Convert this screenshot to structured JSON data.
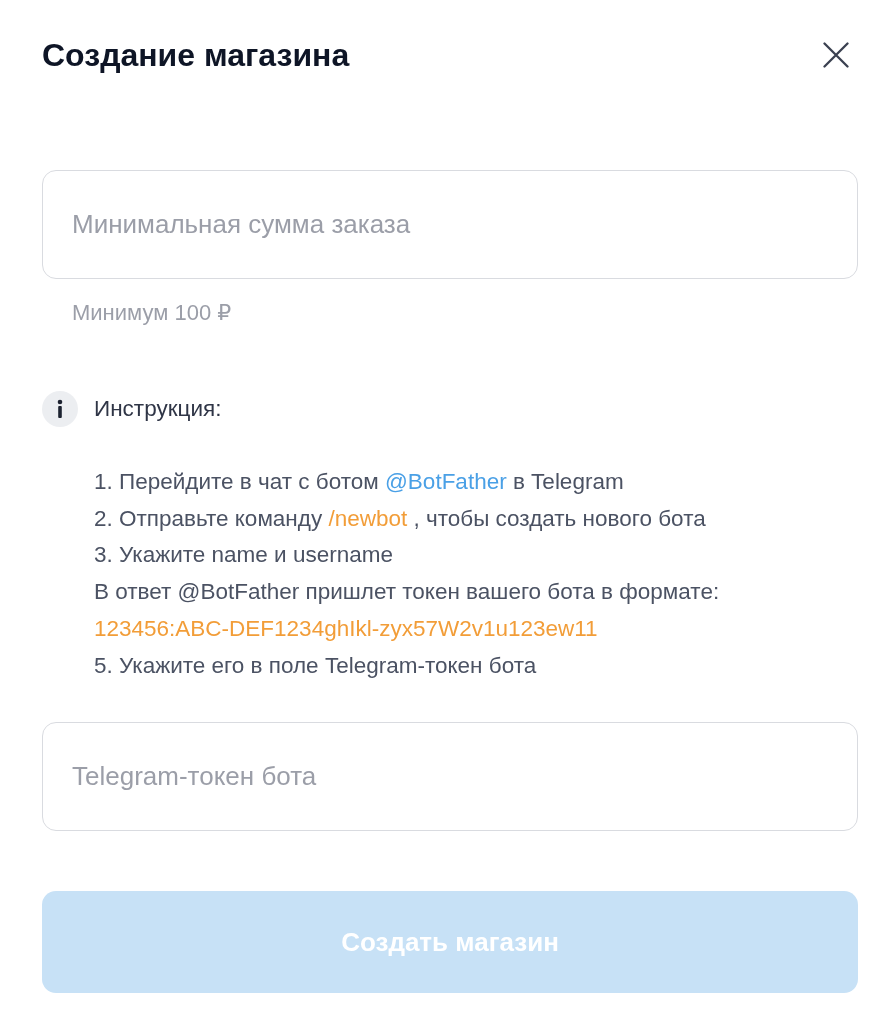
{
  "title": "Создание магазина",
  "min_order_field": {
    "placeholder": "Минимальная сумма заказа",
    "hint": "Минимум 100 ₽"
  },
  "instruction": {
    "heading": "Инструкция:",
    "lines": [
      {
        "kind": "step",
        "segments": [
          {
            "kind": "plain",
            "text": "1. Перейдите в чат с ботом "
          },
          {
            "kind": "link",
            "text": "@BotFather"
          },
          {
            "kind": "plain",
            "text": " в Telegram"
          }
        ]
      },
      {
        "kind": "step",
        "segments": [
          {
            "kind": "plain",
            "text": "2. Отправьте команду "
          },
          {
            "kind": "command",
            "text": "/newbot"
          },
          {
            "kind": "plain",
            "text": " , чтобы создать нового бота"
          }
        ]
      },
      {
        "kind": "step",
        "segments": [
          {
            "kind": "plain",
            "text": "3. Укажите name и username"
          }
        ]
      },
      {
        "kind": "step",
        "segments": [
          {
            "kind": "plain",
            "text": "В ответ @BotFather пришлет токен вашего бота в формате:"
          }
        ]
      },
      {
        "kind": "example",
        "segments": [
          {
            "kind": "plain",
            "text": "123456:ABC-DEF1234ghIkl-zyx57W2v1u123ew11"
          }
        ]
      },
      {
        "kind": "step",
        "segments": [
          {
            "kind": "plain",
            "text": "5. Укажите его в поле Telegram-токен бота"
          }
        ]
      }
    ]
  },
  "token_field": {
    "placeholder": "Telegram-токен бота"
  },
  "submit_button": {
    "label": "Создать магазин",
    "disabled": true
  }
}
